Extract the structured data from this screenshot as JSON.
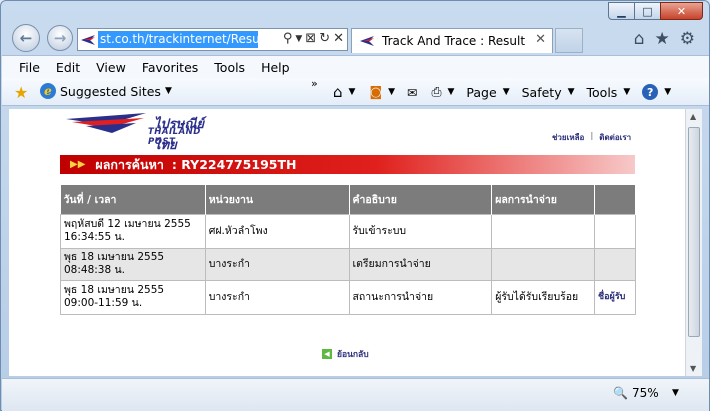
{
  "window": {
    "minimize": "▁",
    "maximize": "□",
    "close": "✕"
  },
  "address": {
    "url": "st.co.th/trackinternet/Result.a"
  },
  "tab": {
    "title": "Track And Trace : Result",
    "close": "✕"
  },
  "menu": [
    "File",
    "Edit",
    "View",
    "Favorites",
    "Tools",
    "Help"
  ],
  "favbar": {
    "suggested": "Suggested Sites",
    "chevron": "»"
  },
  "cmdbar": {
    "page": "Page",
    "safety": "Safety",
    "tools": "Tools"
  },
  "page": {
    "logo_th": "ไปรษณีย์ไทย",
    "logo_en": "THAILAND POST",
    "links": [
      "ช่วยเหลือ",
      "ติดต่อเรา"
    ],
    "result_label": "ผลการค้นหา",
    "tracking_code": ": RY224775195TH",
    "table": {
      "headers": [
        "วันที่ / เวลา",
        "หน่วยงาน",
        "คำอธิบาย",
        "ผลการนำจ่าย",
        ""
      ],
      "rows": [
        {
          "date": "พฤหัสบดี 12 เมษายน 2555",
          "time": "16:34:55 น.",
          "office": "ศฝ.หัวลำโพง",
          "desc": "รับเข้าระบบ",
          "result": "",
          "sig": ""
        },
        {
          "date": "พุธ 18 เมษายน 2555",
          "time": "08:48:38 น.",
          "office": "บางระกำ",
          "desc": "เตรียมการนำจ่าย",
          "result": "",
          "sig": ""
        },
        {
          "date": "พุธ 18 เมษายน 2555",
          "time": "09:00-11:59 น.",
          "office": "บางระกำ",
          "desc": "สถานะการนำจ่าย",
          "result": "ผู้รับได้รับเรียบร้อย",
          "sig": "ชื่อผู้รับ"
        }
      ]
    },
    "back_label": "ย้อนกลับ"
  },
  "status": {
    "zoom": "75%"
  }
}
